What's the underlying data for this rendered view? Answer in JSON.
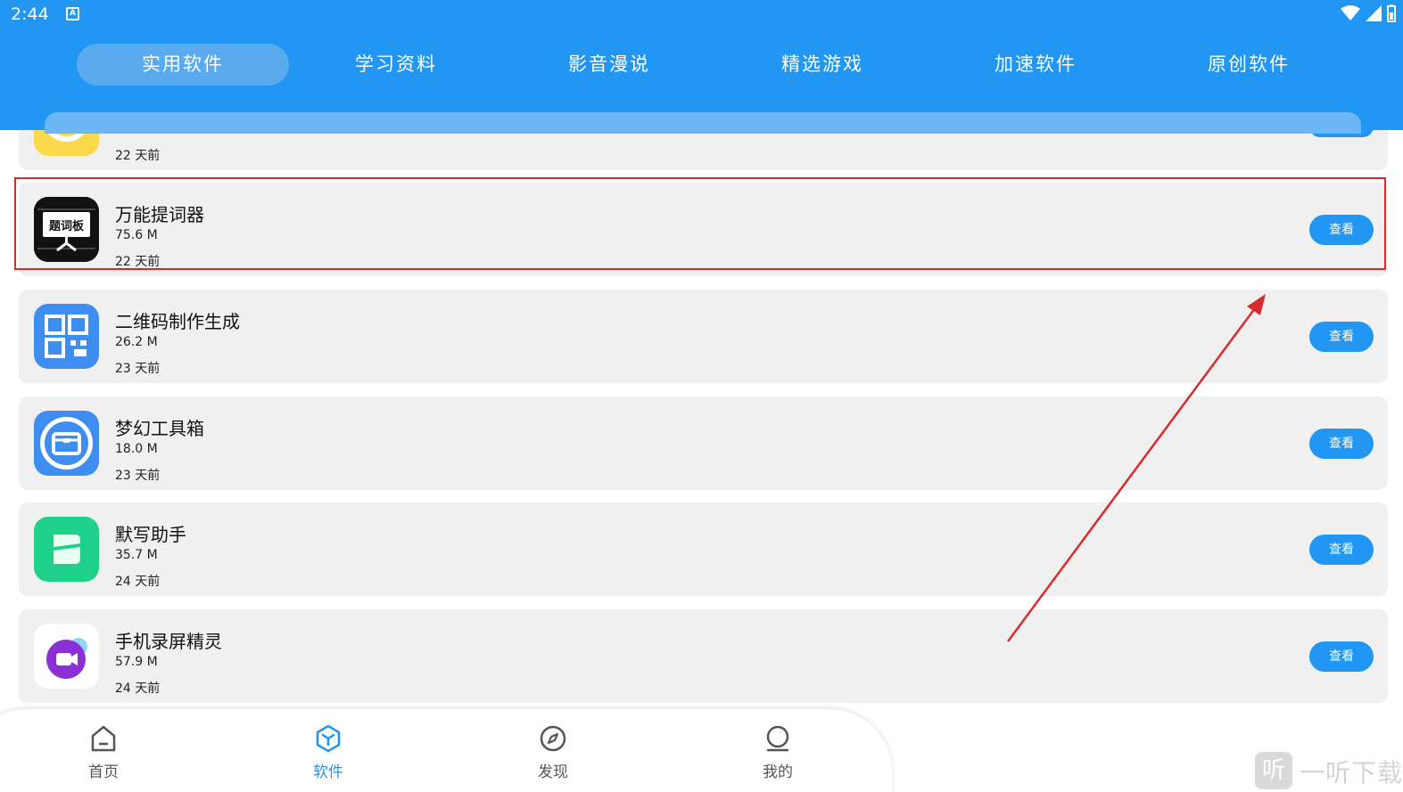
{
  "status_bar": {
    "time": "2:44",
    "notification_icon": "A"
  },
  "tabs": [
    {
      "label": "实用软件",
      "active": true
    },
    {
      "label": "学习资料",
      "active": false
    },
    {
      "label": "影音漫说",
      "active": false
    },
    {
      "label": "精选游戏",
      "active": false
    },
    {
      "label": "加速软件",
      "active": false
    },
    {
      "label": "原创软件",
      "active": false
    }
  ],
  "apps": [
    {
      "name": "",
      "size": "",
      "date": "22 天前",
      "icon": "yellow-app-icon",
      "button": ""
    },
    {
      "name": "万能提词器",
      "size": "75.6 M",
      "date": "22 天前",
      "icon": "teleprompter-icon",
      "icon_text": "题词板",
      "button": "查看"
    },
    {
      "name": "二维码制作生成",
      "size": "26.2 M",
      "date": "23 天前",
      "icon": "qr-code-icon",
      "button": "查看"
    },
    {
      "name": "梦幻工具箱",
      "size": "18.0 M",
      "date": "23 天前",
      "icon": "toolbox-icon",
      "button": "查看"
    },
    {
      "name": "默写助手",
      "size": "35.7 M",
      "date": "24 天前",
      "icon": "dictation-icon",
      "button": "查看"
    },
    {
      "name": "手机录屏精灵",
      "size": "57.9 M",
      "date": "24 天前",
      "icon": "screen-recorder-icon",
      "button": "查看"
    }
  ],
  "bottom_nav": [
    {
      "label": "首页",
      "icon": "home-icon",
      "active": false
    },
    {
      "label": "软件",
      "icon": "software-cube-icon",
      "active": true
    },
    {
      "label": "发现",
      "icon": "compass-icon",
      "active": false
    },
    {
      "label": "我的",
      "icon": "profile-icon",
      "active": false
    }
  ],
  "watermark": {
    "glyph": "听",
    "text": "一听下载"
  },
  "colors": {
    "primary": "#2196f3",
    "card_bg": "#f0f0f0",
    "annotation": "#d82b2b"
  }
}
